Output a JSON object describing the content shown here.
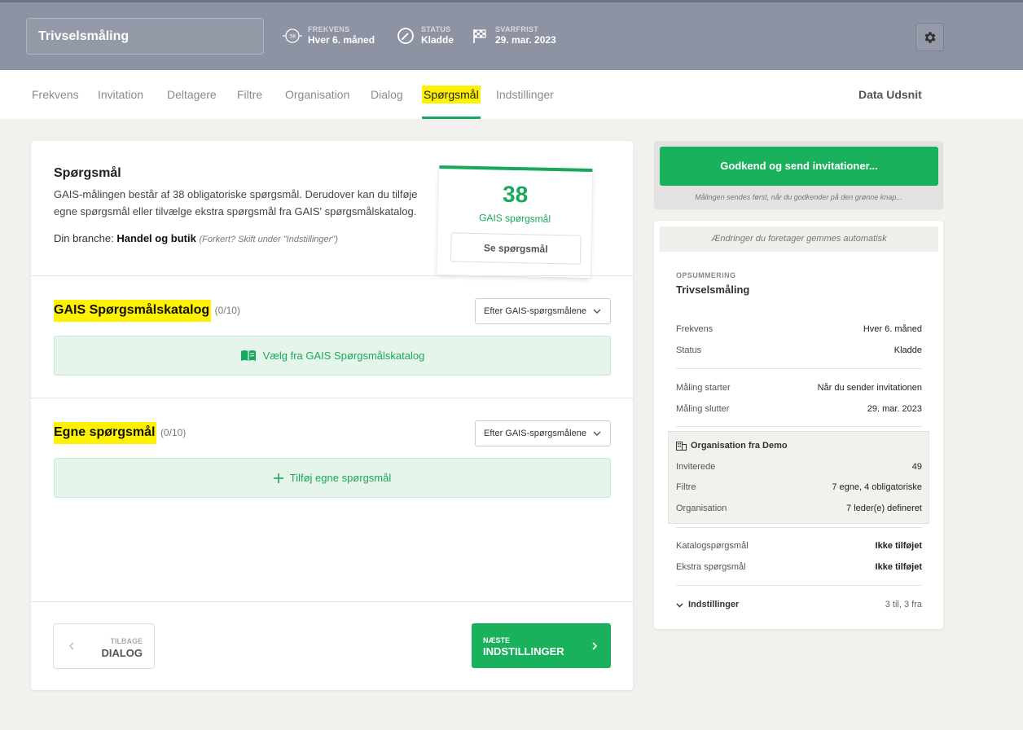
{
  "header": {
    "title": "Trivselsmåling",
    "meta": [
      {
        "label": "FREKVENS",
        "value": "Hver 6. måned",
        "icon": "frequency-38-icon",
        "icon_text": "38"
      },
      {
        "label": "STATUS",
        "value": "Kladde",
        "icon": "pencil-circle-icon"
      },
      {
        "label": "SVARFRIST",
        "value": "29. mar. 2023",
        "icon": "checkered-flag-icon"
      }
    ]
  },
  "tabs": [
    {
      "label": "Frekvens"
    },
    {
      "label": "Invitation"
    },
    {
      "label": "Deltagere"
    },
    {
      "label": "Filtre"
    },
    {
      "label": "Organisation"
    },
    {
      "label": "Dialog"
    },
    {
      "label": "Spørgsmål",
      "active": true
    },
    {
      "label": "Indstillinger"
    }
  ],
  "data_udsnit": "Data Udsnit",
  "intro": {
    "title": "Spørgsmål",
    "description": "GAIS-målingen består af 38 obligatoriske spørgsmål. Derudover kan du tilføje egne spørgsmål eller tilvælge ekstra spørgsmål fra GAIS' spørgsmålskatalog.",
    "branche_prefix": "Din branche: ",
    "branche_value": "Handel og butik",
    "branche_hint": "(Forkert? Skift under \"Indstillinger\")",
    "count": "38",
    "count_label": "GAIS spørgsmål",
    "see_button": "Se spørgsmål"
  },
  "catalog": {
    "title": "GAIS Spørgsmålskatalog",
    "count": "(0/10)",
    "sort": "Efter GAIS-spørgsmålene",
    "add": "Vælg fra GAIS Spørgsmålskatalog"
  },
  "own": {
    "title": "Egne spørgsmål",
    "count": "(0/10)",
    "sort": "Efter GAIS-spørgsmålene",
    "add": "Tilføj egne spørgsmål"
  },
  "nav": {
    "back_small": "TILBAGE",
    "back_big": "DIALOG",
    "next_small": "NÆSTE",
    "next_big": "INDSTILLINGER"
  },
  "approve": {
    "button": "Godkend og send invitationer...",
    "note": "Målingen sendes først, når du godkender på den grønne knap..."
  },
  "summary": {
    "autosave": "Ændringer du foretager gemmes automatisk",
    "label": "OPSUMMERING",
    "name": "Trivselsmåling",
    "rows1": [
      {
        "k": "Frekvens",
        "v": "Hver 6. måned"
      },
      {
        "k": "Status",
        "v": "Kladde"
      }
    ],
    "rows2": [
      {
        "k": "Måling starter",
        "v": "Når du sender invitationen"
      },
      {
        "k": "Måling slutter",
        "v": "29. mar. 2023"
      }
    ],
    "org_title": "Organisation fra Demo",
    "org_rows": [
      {
        "k": "Inviterede",
        "v": "49"
      },
      {
        "k": "Filtre",
        "v": "7 egne, 4 obligatoriske"
      },
      {
        "k": "Organisation",
        "v": "7 leder(e) defineret"
      }
    ],
    "rows3": [
      {
        "k": "Katalogspørgsmål",
        "v": "Ikke tilføjet"
      },
      {
        "k": "Ekstra spørgsmål",
        "v": "Ikke tilføjet"
      }
    ],
    "settings_label": "Indstillinger",
    "settings_value": "3 til, 3 fra"
  },
  "colors": {
    "accent": "#19b15c",
    "header": "#8e93a3",
    "highlight": "#fff200"
  }
}
